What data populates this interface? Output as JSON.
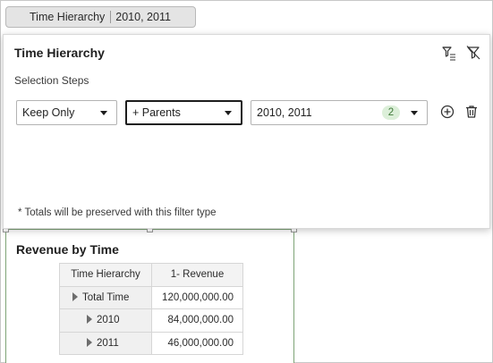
{
  "filter_chip": {
    "label": "Time Hierarchy",
    "value": "2010, 2011"
  },
  "popup": {
    "title": "Time Hierarchy",
    "section_label": "Selection Steps",
    "step": {
      "action": "Keep Only",
      "relation": "+ Parents",
      "members": "2010, 2011",
      "member_count": "2"
    },
    "footnote": "* Totals will be preserved with this filter type",
    "icons": [
      "filter-options-icon",
      "clear-filter-icon",
      "add-step-icon",
      "delete-step-icon"
    ]
  },
  "report": {
    "title": "Revenue by Time",
    "columns": [
      "Time Hierarchy",
      "1- Revenue"
    ],
    "rows": [
      {
        "label": "Total Time",
        "value": "120,000,000.00"
      },
      {
        "label": "2010",
        "value": "84,000,000.00"
      },
      {
        "label": "2011",
        "value": "46,000,000.00"
      }
    ]
  },
  "colors": {
    "badge_bg": "#dcefd9",
    "badge_text": "#3f7a39",
    "report_border": "#7da376",
    "chip_bg": "#e4e4e4"
  }
}
